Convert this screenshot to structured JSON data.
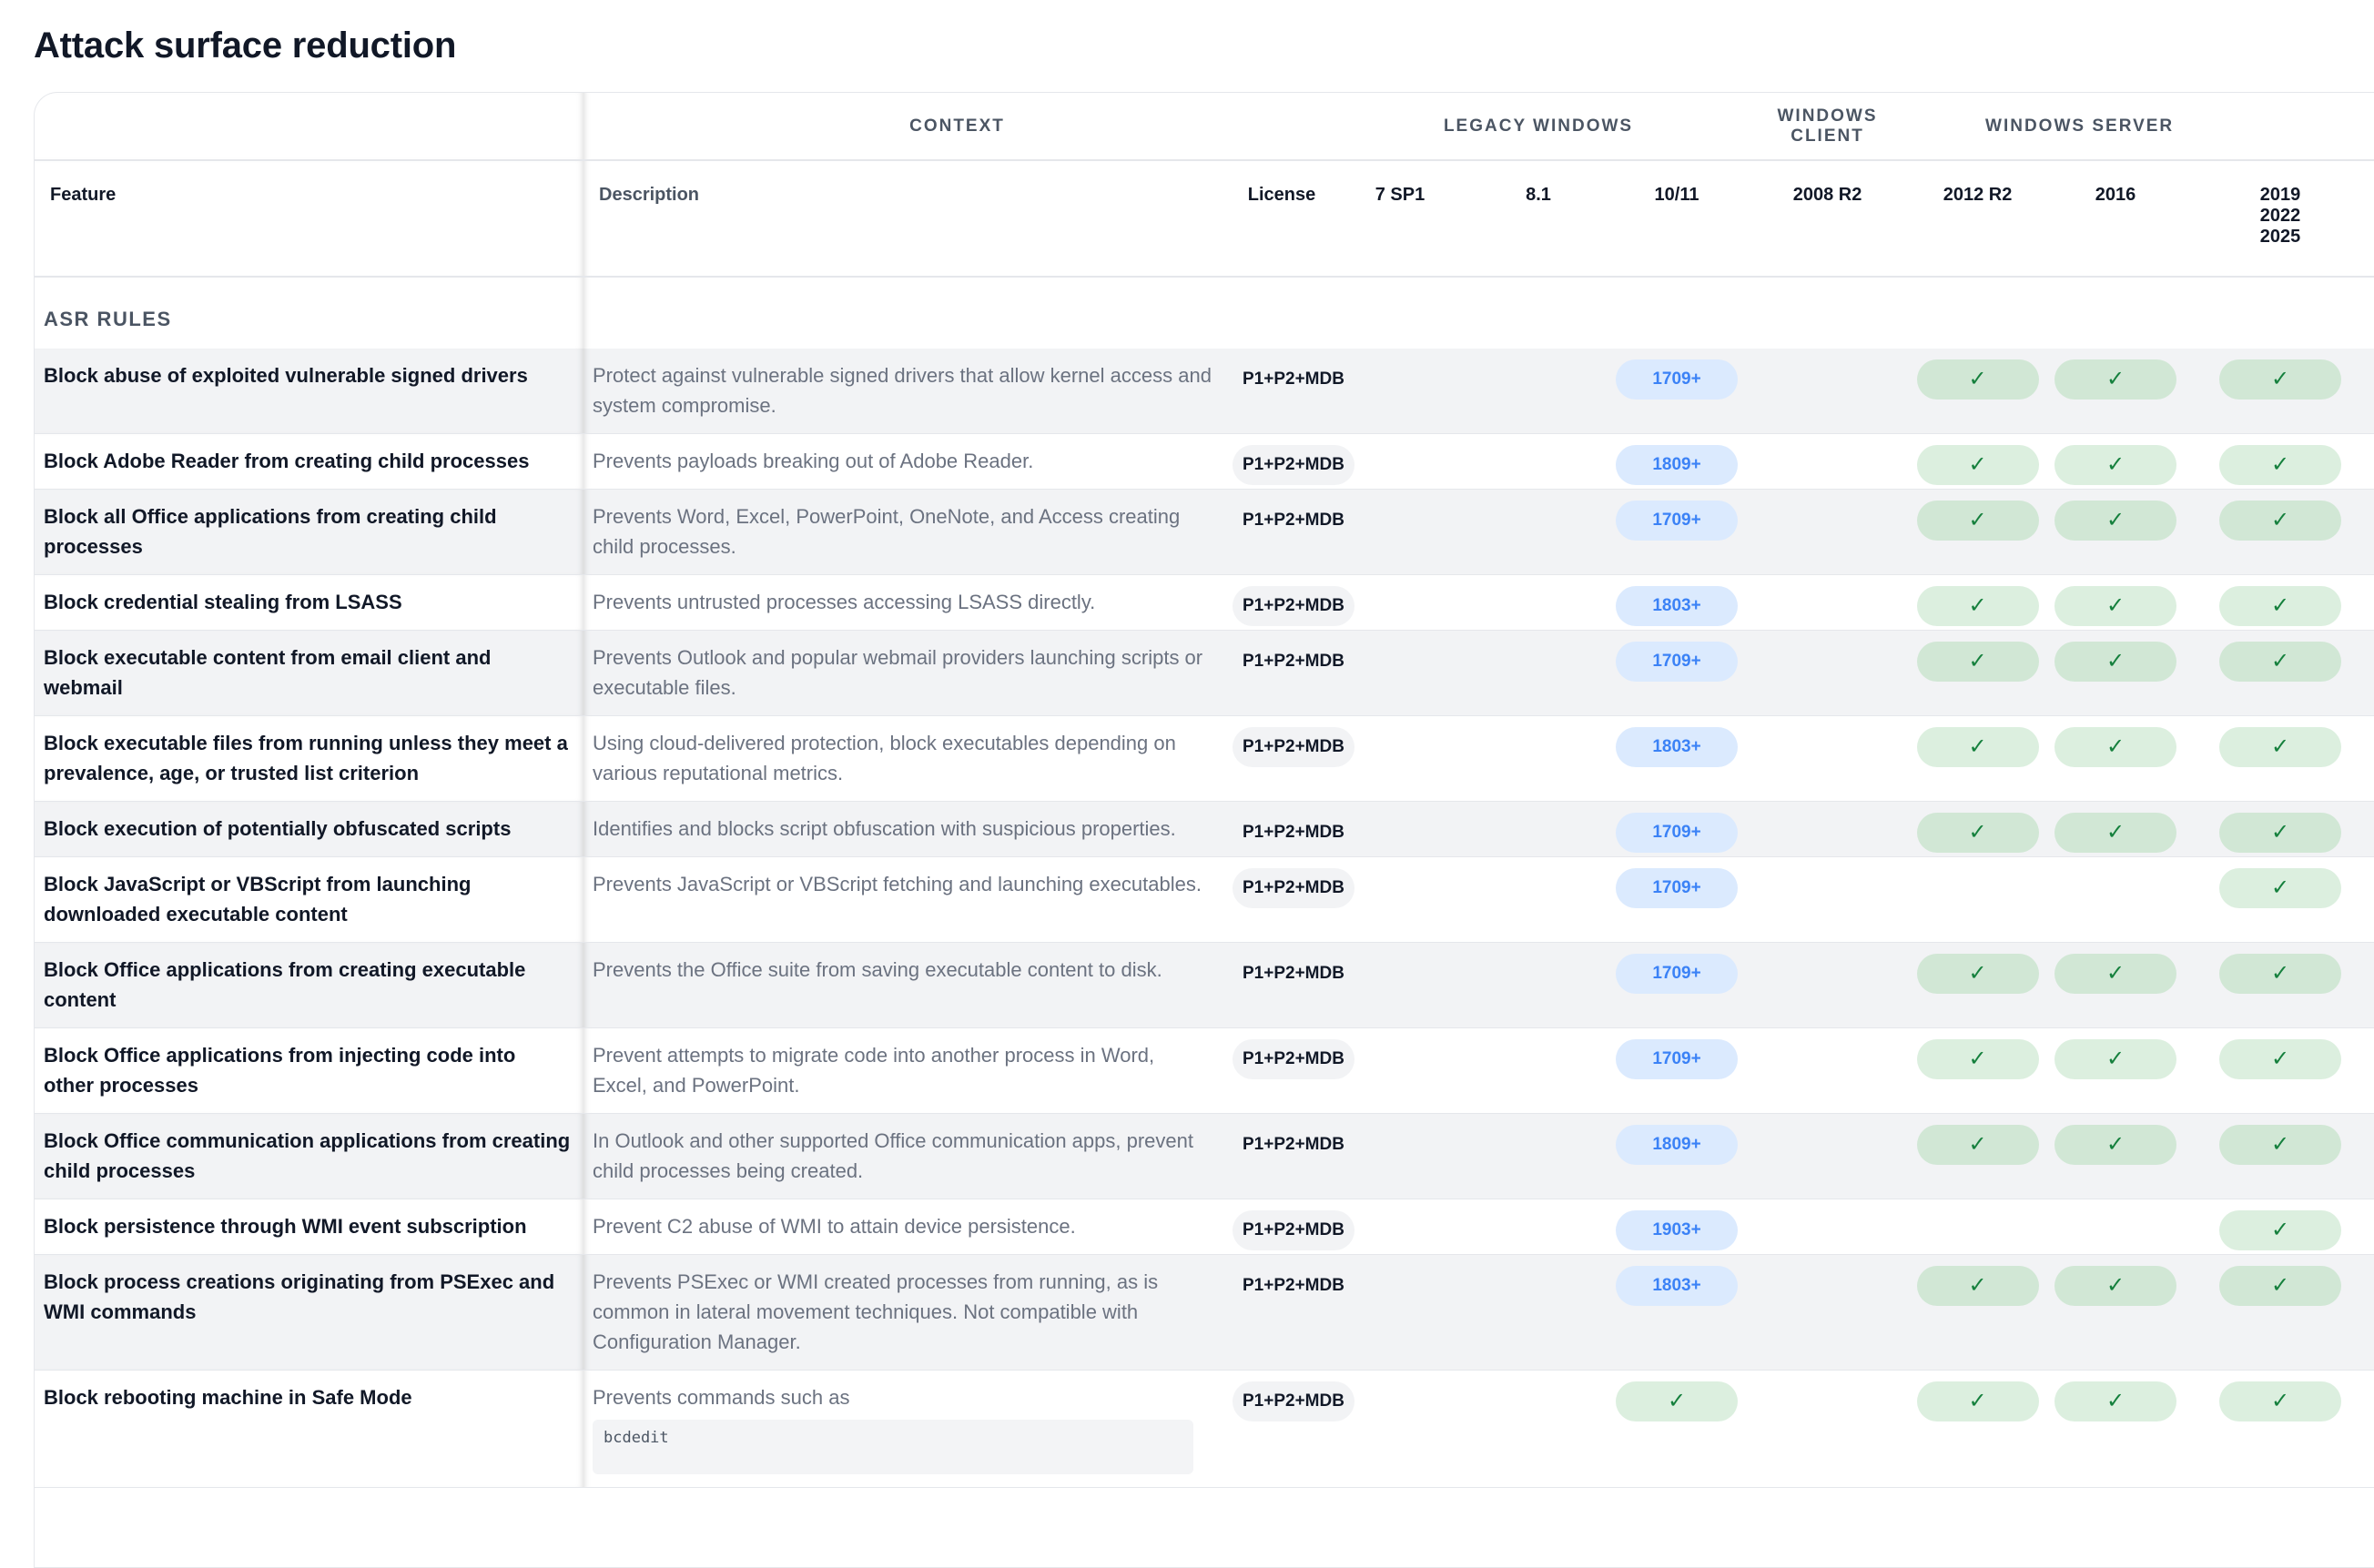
{
  "page": {
    "title": "Attack surface reduction"
  },
  "header": {
    "groups": [
      {
        "label": ""
      },
      {
        "label": "CONTEXT"
      },
      {
        "label": "LEGACY WINDOWS"
      },
      {
        "label": "WINDOWS CLIENT"
      },
      {
        "label": "WINDOWS SERVER"
      }
    ],
    "columns": {
      "feature": "Feature",
      "description": "Description",
      "license": "License",
      "win7": "7 SP1",
      "win81": "8.1",
      "win1011": "10/11",
      "srv2008": "2008 R2",
      "srv2012": "2012 R2",
      "srv2016": "2016",
      "srv2019": "2019\n2022\n2025"
    }
  },
  "section": {
    "label": "ASR RULES"
  },
  "check_glyph": "✓",
  "rows": [
    {
      "feature": "Block abuse of exploited vulnerable signed drivers",
      "description": "Protect against vulnerable signed drivers that allow kernel access and system compromise.",
      "license": "P1+P2+MDB",
      "client": "1709+",
      "s2012": true,
      "s2016": true,
      "s2019": true
    },
    {
      "feature": "Block Adobe Reader from creating child processes",
      "description": "Prevents payloads breaking out of Adobe Reader.",
      "license": "P1+P2+MDB",
      "client": "1809+",
      "s2012": true,
      "s2016": true,
      "s2019": true
    },
    {
      "feature": "Block all Office applications from creating child processes",
      "description": "Prevents Word, Excel, PowerPoint, OneNote, and Access creating child processes.",
      "license": "P1+P2+MDB",
      "client": "1709+",
      "s2012": true,
      "s2016": true,
      "s2019": true
    },
    {
      "feature": "Block credential stealing from LSASS",
      "description": "Prevents untrusted processes accessing LSASS directly.",
      "license": "P1+P2+MDB",
      "client": "1803+",
      "s2012": true,
      "s2016": true,
      "s2019": true
    },
    {
      "feature": "Block executable content from email client and webmail",
      "description": "Prevents Outlook and popular webmail providers launching scripts or executable files.",
      "license": "P1+P2+MDB",
      "client": "1709+",
      "s2012": true,
      "s2016": true,
      "s2019": true
    },
    {
      "feature": "Block executable files from running unless they meet a prevalence, age, or trusted list criterion",
      "description": "Using cloud-delivered protection, block executables depending on various reputational metrics.",
      "license": "P1+P2+MDB",
      "client": "1803+",
      "s2012": true,
      "s2016": true,
      "s2019": true
    },
    {
      "feature": "Block execution of potentially obfuscated scripts",
      "description": "Identifies and blocks script obfuscation with suspicious properties.",
      "license": "P1+P2+MDB",
      "client": "1709+",
      "s2012": true,
      "s2016": true,
      "s2019": true
    },
    {
      "feature": "Block JavaScript or VBScript from launching downloaded executable content",
      "description": "Prevents JavaScript or VBScript fetching and launching executables.",
      "license": "P1+P2+MDB",
      "client": "1709+",
      "s2012": false,
      "s2016": false,
      "s2019": true
    },
    {
      "feature": "Block Office applications from creating executable content",
      "description": "Prevents the Office suite from saving executable content to disk.",
      "license": "P1+P2+MDB",
      "client": "1709+",
      "s2012": true,
      "s2016": true,
      "s2019": true
    },
    {
      "feature": "Block Office applications from injecting code into other processes",
      "description": "Prevent attempts to migrate code into another process in Word, Excel, and PowerPoint.",
      "license": "P1+P2+MDB",
      "client": "1709+",
      "s2012": true,
      "s2016": true,
      "s2019": true
    },
    {
      "feature": "Block Office communication applications from creating child processes",
      "description": "In Outlook and other supported Office communication apps, prevent child processes being created.",
      "license": "P1+P2+MDB",
      "client": "1809+",
      "s2012": true,
      "s2016": true,
      "s2019": true
    },
    {
      "feature": "Block persistence through WMI event subscription",
      "description": "Prevent C2 abuse of WMI to attain device persistence.",
      "license": "P1+P2+MDB",
      "client": "1903+",
      "s2012": false,
      "s2016": false,
      "s2019": true
    },
    {
      "feature": "Block process creations originating from PSExec and WMI commands",
      "description": "Prevents PSExec or WMI created processes from running, as is common in lateral movement techniques. Not compatible with Configuration Manager.",
      "license": "P1+P2+MDB",
      "client": "1803+",
      "s2012": true,
      "s2016": true,
      "s2019": true
    },
    {
      "feature": "Block rebooting machine in Safe Mode",
      "description": "Prevents commands such as",
      "code": "bcdedit",
      "license": "P1+P2+MDB",
      "client": "check",
      "s2012": true,
      "s2016": true,
      "s2019": true
    }
  ]
}
